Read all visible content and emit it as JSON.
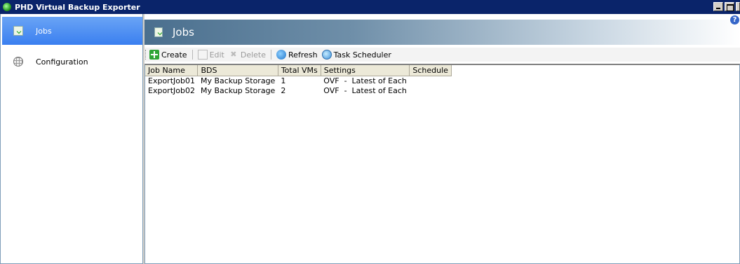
{
  "window": {
    "title": "PHD Virtual Backup Exporter"
  },
  "sidebar": {
    "items": [
      {
        "label": "Jobs",
        "icon": "jobs-icon",
        "active": true
      },
      {
        "label": "Configuration",
        "icon": "globe-icon",
        "active": false
      }
    ]
  },
  "header": {
    "title": "Jobs",
    "help_symbol": "?"
  },
  "toolbar": {
    "create_label": "Create",
    "edit_label": "Edit",
    "delete_label": "Delete",
    "refresh_label": "Refresh",
    "scheduler_label": "Task Scheduler"
  },
  "table": {
    "columns": [
      "Job Name",
      "BDS",
      "Total VMs",
      "Settings",
      "Schedule"
    ],
    "rows": [
      [
        "ExportJob01",
        "My Backup Storage",
        "1",
        "OVF  -  Latest of Each",
        ""
      ],
      [
        "ExportJob02",
        "My Backup Storage",
        "2",
        "OVF  -  Latest of Each",
        ""
      ]
    ]
  },
  "colors": {
    "titlebar": "#0a246a",
    "active_item": "#3a7ff0",
    "header_band": "#4a6f8e"
  }
}
